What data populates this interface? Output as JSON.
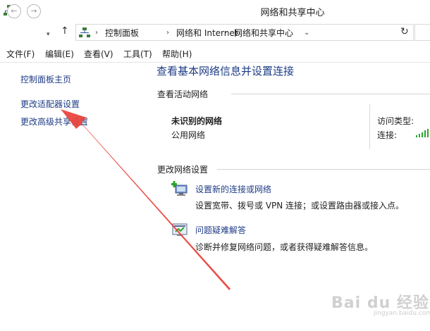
{
  "window": {
    "title": "网络和共享中心"
  },
  "address": {
    "crumbs": [
      "控制面板",
      "网络和 Internet",
      "网络和共享中心"
    ]
  },
  "menu": {
    "file": "文件(F)",
    "edit": "编辑(E)",
    "view": "查看(V)",
    "tools": "工具(T)",
    "help": "帮助(H)"
  },
  "sidebar": {
    "items": [
      {
        "label": "控制面板主页"
      },
      {
        "label": "更改适配器设置"
      },
      {
        "label": "更改高级共享设置"
      }
    ]
  },
  "main": {
    "title": "查看基本网络信息并设置连接",
    "active_networks": {
      "heading": "查看活动网络",
      "network_name": "未识别的网络",
      "network_type": "公用网络",
      "access_type_label": "访问类型:",
      "connection_label": "连接:"
    },
    "change_settings": {
      "heading": "更改网络设置",
      "tasks": [
        {
          "link": "设置新的连接或网络",
          "description": "设置宽带、拨号或 VPN 连接；或设置路由器或接入点。"
        },
        {
          "link": "问题疑难解答",
          "description": "诊断并修复网络问题，或者获得疑难解答信息。"
        }
      ]
    }
  },
  "watermark": {
    "text": "Bai du 经验",
    "sub": "jingyan.baidu.com"
  },
  "colors": {
    "link": "#1e3c85",
    "arrow": "#e8403a",
    "signal": "#2aa52a"
  }
}
